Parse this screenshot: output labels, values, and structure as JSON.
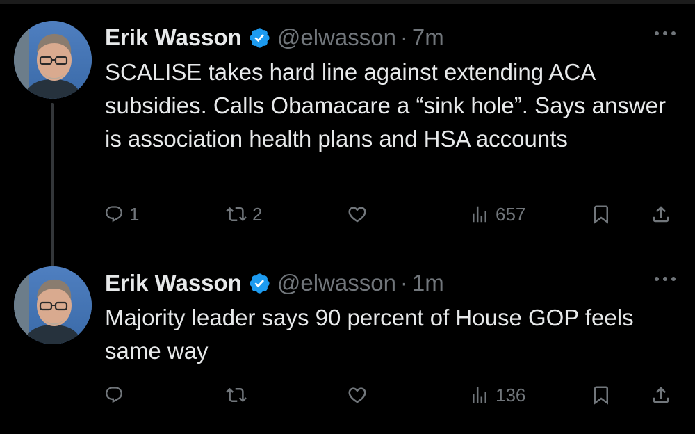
{
  "tweets": [
    {
      "author_name": "Erik Wasson",
      "handle": "@elwasson",
      "separator": "·",
      "time": "7m",
      "text": "SCALISE takes hard line against extending ACA subsidies. Calls Obamacare a “sink hole”. Says answer is association health plans and HSA accounts",
      "replies": "1",
      "reposts": "2",
      "likes": "",
      "views": "657"
    },
    {
      "author_name": "Erik Wasson",
      "handle": "@elwasson",
      "separator": "·",
      "time": "1m",
      "text": "Majority leader says 90 percent of House GOP feels same way",
      "replies": "",
      "reposts": "",
      "likes": "",
      "views": "136"
    }
  ],
  "colors": {
    "background": "#000000",
    "text_primary": "#e7e9ea",
    "text_secondary": "#71767b",
    "verified": "#1d9bf0",
    "thread_line": "#333639"
  },
  "icons": {
    "reply": "reply-icon",
    "repost": "repost-icon",
    "like": "like-icon",
    "views": "views-icon",
    "bookmark": "bookmark-icon",
    "share": "share-icon",
    "more": "more-icon",
    "verified": "verified-badge-icon"
  }
}
